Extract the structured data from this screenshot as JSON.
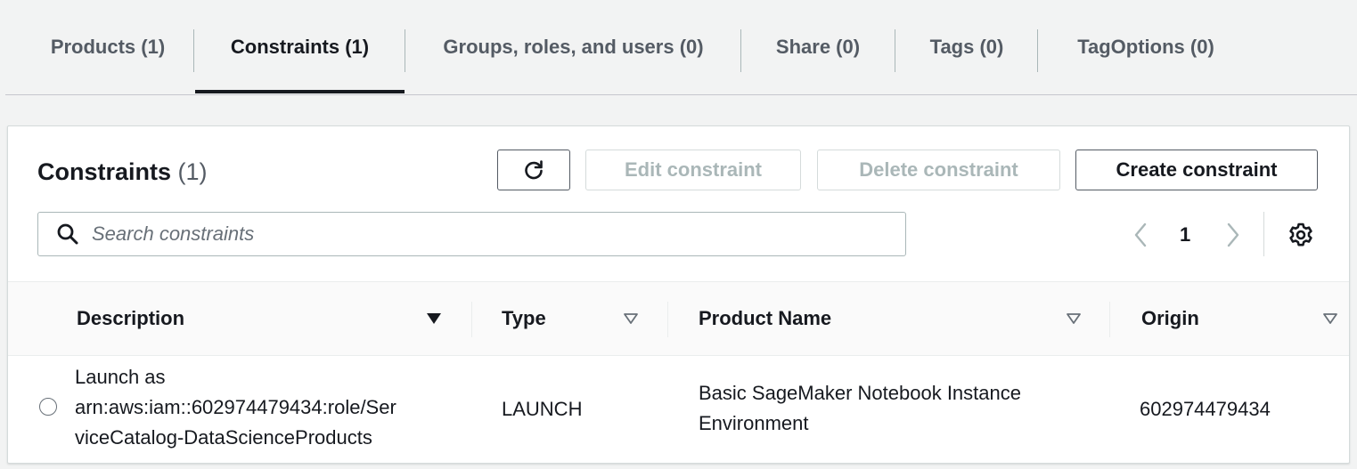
{
  "tabs": [
    {
      "label": "Products (1)"
    },
    {
      "label": "Constraints (1)"
    },
    {
      "label": "Groups, roles, and users (0)"
    },
    {
      "label": "Share (0)"
    },
    {
      "label": "Tags (0)"
    },
    {
      "label": "TagOptions (0)"
    }
  ],
  "active_tab": "Constraints (1)",
  "panel": {
    "title": "Constraints",
    "count": "(1)",
    "buttons": {
      "refresh_icon": "refresh-icon",
      "edit": "Edit constraint",
      "delete": "Delete constraint",
      "create": "Create constraint"
    },
    "search_placeholder": "Search constraints",
    "pagination": {
      "current_page": "1"
    }
  },
  "table": {
    "columns": [
      {
        "label": "Description",
        "sort": "sorted-descending"
      },
      {
        "label": "Type",
        "sort": "unsorted"
      },
      {
        "label": "Product Name",
        "sort": "unsorted"
      },
      {
        "label": "Origin",
        "sort": "unsorted"
      }
    ],
    "rows": [
      {
        "description_lines": [
          "Launch as",
          "arn:aws:iam::602974479434:role/Ser",
          "viceCatalog-DataScienceProducts"
        ],
        "type": "LAUNCH",
        "product_name_lines": [
          "Basic SageMaker Notebook Instance",
          "Environment"
        ],
        "origin": "602974479434"
      }
    ]
  },
  "colors": {
    "background": "#f2f3f3",
    "text_primary": "#16191f",
    "text_secondary": "#545b64",
    "disabled": "#aab7b8"
  }
}
